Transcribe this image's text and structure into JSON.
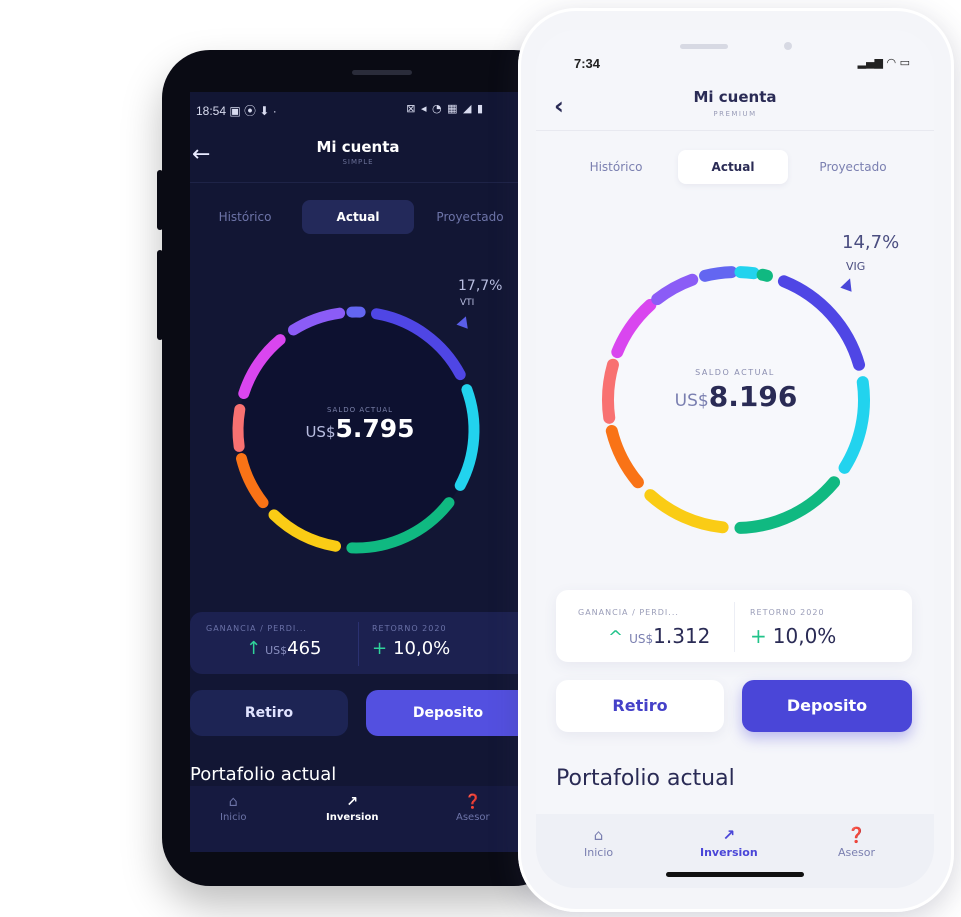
{
  "dark_phone": {
    "status": {
      "time": "18:54",
      "left_icons": "▣ ⦿ ⬇ ·",
      "right_icons": "⊠ ◂ ◔ ▦ ◢ ▮"
    },
    "header": {
      "title": "Mi cuenta",
      "subtitle": "SIMPLE"
    },
    "tabs": [
      {
        "label": "Histórico",
        "active": false
      },
      {
        "label": "Actual",
        "active": true
      },
      {
        "label": "Proyectado",
        "active": false
      }
    ],
    "donut": {
      "highlight_pct": "17,7%",
      "highlight_label": "VTI",
      "balance_label": "SALDO ACTUAL",
      "balance_currency": "US$",
      "balance_value": "5.795"
    },
    "stats": {
      "gain_label": "GANANCIA / PERDI...",
      "gain_currency": "US$",
      "gain_value": "465",
      "return_label": "RETORNO 2020",
      "return_value": "10,0%"
    },
    "buttons": {
      "retiro": "Retiro",
      "deposito": "Deposito"
    },
    "portfolio_title": "Portafolio actual",
    "nav": [
      {
        "label": "Inicio",
        "icon": "home-icon",
        "active": false
      },
      {
        "label": "Inversion",
        "icon": "trend-icon",
        "active": true
      },
      {
        "label": "Asesor",
        "icon": "help-icon",
        "active": false
      }
    ]
  },
  "light_phone": {
    "status": {
      "time": "7:34",
      "right_icons": "▂▄▆ ◠ ▭"
    },
    "header": {
      "title": "Mi cuenta",
      "subtitle": "PREMIUM"
    },
    "tabs": [
      {
        "label": "Histórico",
        "active": false
      },
      {
        "label": "Actual",
        "active": true
      },
      {
        "label": "Proyectado",
        "active": false
      }
    ],
    "donut": {
      "highlight_pct": "14,7%",
      "highlight_label": "VIG",
      "balance_label": "SALDO ACTUAL",
      "balance_currency": "US$",
      "balance_value": "8.196"
    },
    "stats": {
      "gain_label": "GANANCIA / PERDI...",
      "gain_currency": "US$",
      "gain_value": "1.312",
      "return_label": "RETORNO 2020",
      "return_value": "10,0%"
    },
    "buttons": {
      "retiro": "Retiro",
      "deposito": "Deposito"
    },
    "portfolio_title": "Portafolio actual",
    "nav": [
      {
        "label": "Inicio",
        "icon": "home-icon",
        "active": false
      },
      {
        "label": "Inversion",
        "icon": "trend-icon",
        "active": true
      },
      {
        "label": "Asesor",
        "icon": "help-icon",
        "active": false
      }
    ]
  },
  "donut_segment_colors": [
    "#4f46e5",
    "#22d3ee",
    "#10b981",
    "#facc15",
    "#f97316",
    "#f87171",
    "#d946ef",
    "#8b5cf6",
    "#6366f1"
  ]
}
